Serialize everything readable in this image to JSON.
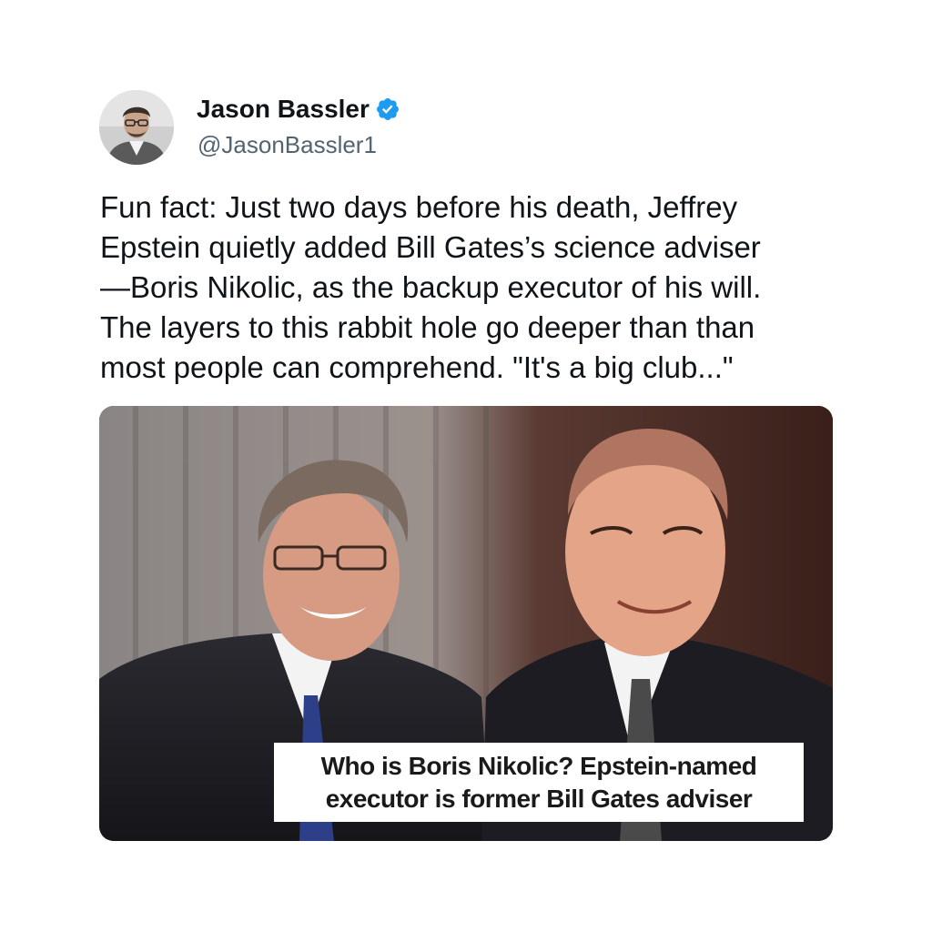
{
  "author": {
    "display_name": "Jason Bassler",
    "handle": "@JasonBassler1",
    "avatar_icon": "profile-photo",
    "verified_icon": "verified-badge-icon",
    "verified_color": "#1d9bf0"
  },
  "tweet": {
    "text": "Fun fact: Just two days before his death, Jeffrey\nEpstein quietly added Bill Gates’s science adviser\n—Boris Nikolic, as the backup executor of his will.\nThe layers to this rabbit hole go deeper than than\nmost people can comprehend. \"It's a big club...\""
  },
  "media": {
    "headline": "Who is Boris Nikolic? Epstein-named\nexecutor is former Bill Gates adviser"
  }
}
